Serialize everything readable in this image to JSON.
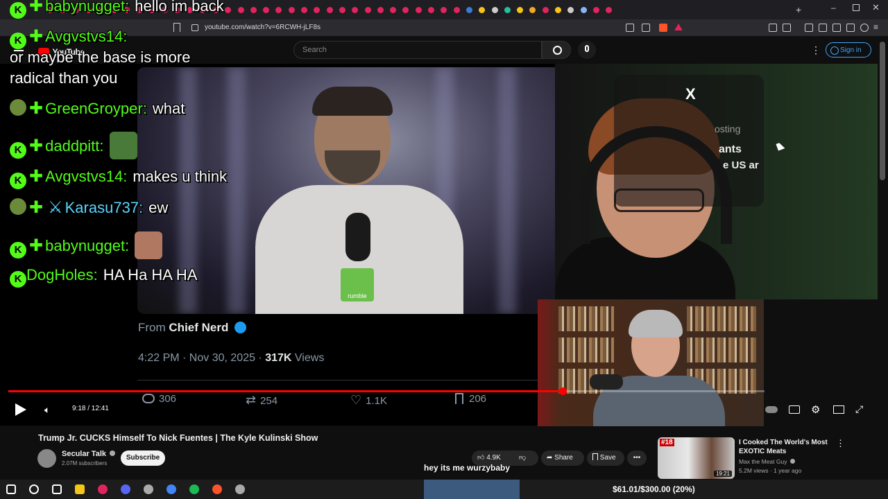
{
  "browser": {
    "url": "youtube.com/watch?v=6RCWH-jLF8s",
    "tab_colors": [
      "#e0245e",
      "#e0245e",
      "#e0245e",
      "#e0245e",
      "#e0245e",
      "#e0245e",
      "#e0245e",
      "#e0245e",
      "#e0245e",
      "#e0245e",
      "#e0245e",
      "#e0245e",
      "#e0245e",
      "#e0245e",
      "#e0245e",
      "#e0245e",
      "#e0245e",
      "#e0245e",
      "#e0245e",
      "#e0245e",
      "#e0245e",
      "#e0245e",
      "#e0245e",
      "#e0245e",
      "#e0245e",
      "#e0245e",
      "#e0245e",
      "#e0245e",
      "#e0245e",
      "#e0245e",
      "#e0245e",
      "#e0245e",
      "#e0245e",
      "#3a7bd5",
      "#f5c518",
      "#cccccc",
      "#22c1a0",
      "#f5c518",
      "#f5a623",
      "#e0245e",
      "#f5c518",
      "#cccccc",
      "#8ab4f8",
      "#e0245e",
      "#e0245e"
    ],
    "new_tab_icon": "plus-icon"
  },
  "youtube": {
    "logo_text": "YouTube",
    "search_placeholder": "Search",
    "sign_in_label": "Sign in"
  },
  "chat": [
    {
      "user": "babynugget:",
      "msg": "hello im back",
      "badges": [
        "kick",
        "plus"
      ]
    },
    {
      "user": "Avgvstvs14:",
      "msg": "",
      "badges": [
        "kick",
        "plus"
      ]
    },
    {
      "user": "",
      "msg": "or maybe the base is more",
      "badges": []
    },
    {
      "user": "",
      "msg": "radical than you",
      "badges": []
    },
    {
      "user": "GreenGroyper:",
      "msg": "what",
      "badges": [
        "avatar",
        "plus"
      ]
    },
    {
      "user": "daddpitt:",
      "msg": "",
      "badges": [
        "kick",
        "plus"
      ],
      "emote": true
    },
    {
      "user": "Avgvstvs14:",
      "msg": "makes u think",
      "badges": [
        "kick",
        "plus"
      ]
    },
    {
      "user": "Karasu737:",
      "msg": "ew",
      "badges": [
        "avatar",
        "plus",
        "sword"
      ]
    },
    {
      "user": "babynugget:",
      "msg": "",
      "badges": [
        "kick",
        "plus"
      ],
      "emote": true
    },
    {
      "user": "DogHoles:",
      "msg": "HA Ha HA HA",
      "badges": [
        "kick"
      ]
    }
  ],
  "tweet": {
    "from_label": "From",
    "source": "Chief Nerd",
    "time": "4:22 PM · Nov 30, 2025 ·",
    "views_count": "317K",
    "views_label": "Views",
    "replies": "306",
    "retweets": "254",
    "likes": "1.1K",
    "bookmarks": "206",
    "clip_logo": "rumble"
  },
  "stream_overlay": {
    "title_fragment": "X",
    "line1": "osting",
    "line2": "ants",
    "line3": "e US ar"
  },
  "player": {
    "time": "9:18 / 12:41",
    "progress": 0.733
  },
  "video": {
    "title": "Trump Jr. CUCKS Himself To Nick Fuentes | The Kyle Kulinski Show",
    "channel": "Secular Talk",
    "subscribers": "2.07M subscribers",
    "subscribe_label": "Subscribe",
    "likes": "4.9K",
    "share_label": "Share",
    "save_label": "Save"
  },
  "caption": "hey its me wurzybaby",
  "recommendation": {
    "rank": "#18",
    "duration": "19:21",
    "title": "I Cooked The World's Most EXOTIC Meats",
    "channel": "Max the Meat Guy",
    "meta": "5.2M views · 1 year ago"
  },
  "taskbar": {
    "goal_text": "$61.01/$300.00 (20%)",
    "icons": [
      "windows-icon",
      "search-icon",
      "task-view-icon",
      "file-explorer-icon",
      "app-icon",
      "discord-icon",
      "app-icon",
      "chrome-icon",
      "spotify-icon",
      "brave-icon",
      "app-icon"
    ]
  },
  "colors": {
    "kick_green": "#53fc18",
    "yt_red": "#ff0000",
    "twitter_blue": "#1d9bf0"
  }
}
